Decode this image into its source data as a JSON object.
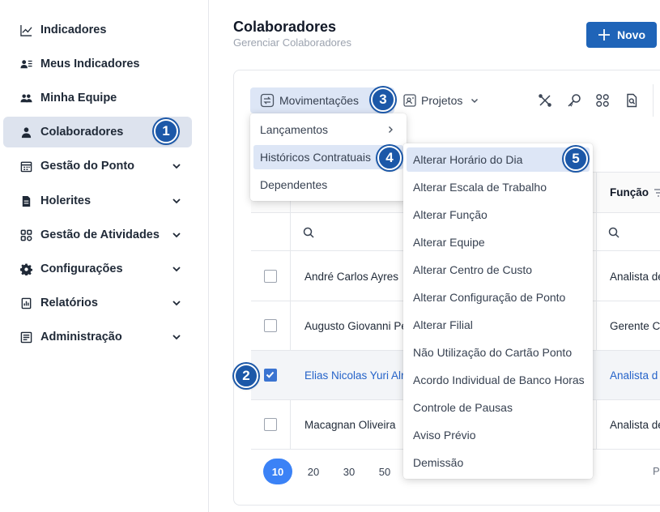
{
  "sidebar": {
    "items": [
      {
        "label": "Indicadores",
        "icon": "chart-line-icon",
        "chevron": false
      },
      {
        "label": "Meus Indicadores",
        "icon": "user-list-icon",
        "chevron": false
      },
      {
        "label": "Minha Equipe",
        "icon": "users-icon",
        "chevron": false
      },
      {
        "label": "Colaboradores",
        "icon": "user-icon",
        "chevron": false,
        "active": true
      },
      {
        "label": "Gestão do Ponto",
        "icon": "calendar-icon",
        "chevron": true
      },
      {
        "label": "Holerites",
        "icon": "document-icon",
        "chevron": true
      },
      {
        "label": "Gestão de Atividades",
        "icon": "grid-icon",
        "chevron": true
      },
      {
        "label": "Configurações",
        "icon": "gear-icon",
        "chevron": true
      },
      {
        "label": "Relatórios",
        "icon": "report-icon",
        "chevron": true
      },
      {
        "label": "Administração",
        "icon": "admin-icon",
        "chevron": true
      }
    ]
  },
  "header": {
    "title": "Colaboradores",
    "subtitle": "Gerenciar Colaboradores",
    "new_button": "Novo"
  },
  "toolbar": {
    "movimentacoes": "Movimentações",
    "projetos": "Projetos"
  },
  "table": {
    "func_header": "Função",
    "rows": [
      {
        "name": "André Carlos Ayres",
        "func": "Analista de",
        "checked": false
      },
      {
        "name": "Augusto Giovanni Pe",
        "func": "Gerente C",
        "checked": false
      },
      {
        "name": "Elias Nicolas Yuri Alr",
        "func": "Analista d",
        "checked": true
      },
      {
        "name": "Macagnan Oliveira",
        "func": "Analista de",
        "checked": false
      }
    ]
  },
  "pagination": {
    "sizes": [
      "10",
      "20",
      "30",
      "50"
    ],
    "active": "10",
    "trailing": "P"
  },
  "menu_main": {
    "items": [
      "Lançamentos",
      "Históricos Contratuais",
      "Dependentes"
    ]
  },
  "menu_sub": {
    "items": [
      "Alterar Horário do Dia",
      "Alterar Escala de Trabalho",
      "Alterar Função",
      "Alterar Equipe",
      "Alterar Centro de Custo",
      "Alterar Configuração de Ponto",
      "Alterar Filial",
      "Não Utilização do Cartão Ponto",
      "Acordo Individual de Banco Horas",
      "Controle de Pausas",
      "Aviso Prévio",
      "Demissão"
    ]
  },
  "badges": [
    "1",
    "2",
    "3",
    "4",
    "5"
  ],
  "colors": {
    "accent": "#1f64b8",
    "badge": "#1c58a8",
    "highlight": "#dde6f6",
    "selected_text": "#2563c9"
  }
}
